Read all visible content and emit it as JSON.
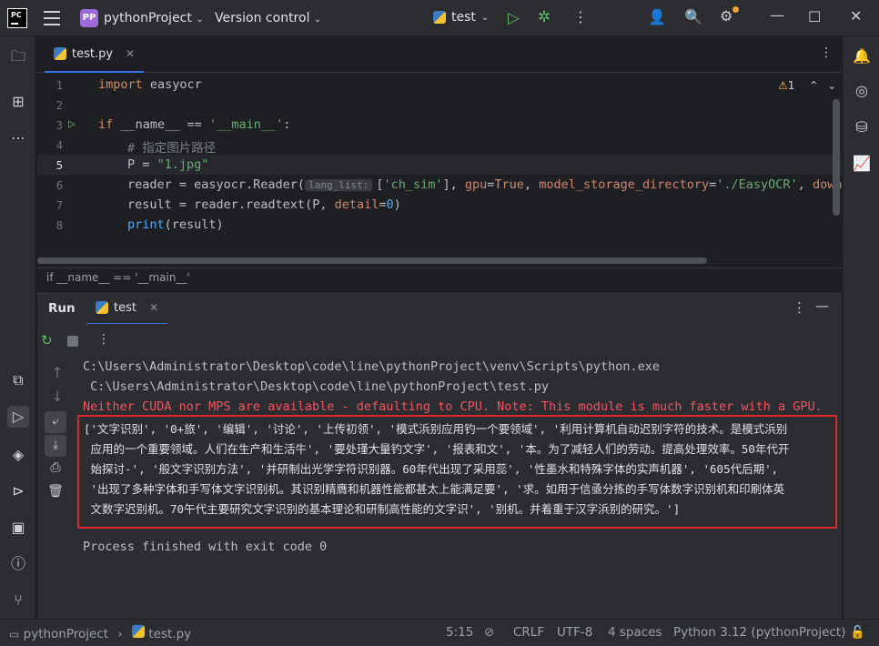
{
  "titlebar": {
    "logo": "PC",
    "project_badge": "PP",
    "project_name": "pythonProject",
    "vcs_label": "Version control",
    "run_config": "test"
  },
  "editor": {
    "tab_label": "test.py",
    "warnings_count": "1",
    "lines": [
      {
        "n": "1"
      },
      {
        "n": "2"
      },
      {
        "n": "3"
      },
      {
        "n": "4"
      },
      {
        "n": "5"
      },
      {
        "n": "6"
      },
      {
        "n": "7"
      },
      {
        "n": "8"
      }
    ],
    "code": {
      "l1_kw": "import",
      "l1_rest": " easyocr",
      "l3_kw": "if",
      "l3_mid": " __name__ == ",
      "l3_str": "'__main__'",
      "l3_end": ":",
      "l4": "# 指定图片路径",
      "l5_a": "P = ",
      "l5_str": "\"1.jpg\"",
      "l6_a": "reader = easyocr.Reader(",
      "l6_hint": "lang_list:",
      "l6_b": "[",
      "l6_s1": "'ch_sim'",
      "l6_c": "], ",
      "l6_p1": "gpu",
      "l6_d": "=",
      "l6_kw": "True",
      "l6_e": ", ",
      "l6_p2": "model_storage_directory",
      "l6_f": "=",
      "l6_s2": "'./EasyOCR'",
      "l6_g": ", ",
      "l6_p3": "downloa",
      "l7_a": "result = reader.readtext(P, ",
      "l7_p": "detail",
      "l7_b": "=",
      "l7_n": "0",
      "l7_c": ")",
      "l8_fn": "print",
      "l8_rest": "(result)"
    },
    "breadcrumb": "if __name__ == '__main__'"
  },
  "run_panel": {
    "title": "Run",
    "tab_label": "test",
    "console": {
      "line1": "C:\\Users\\Administrator\\Desktop\\code\\line\\pythonProject\\venv\\Scripts\\python.exe",
      "line2": " C:\\Users\\Administrator\\Desktop\\code\\line\\pythonProject\\test.py",
      "line3": "Neither CUDA nor MPS are available - defaulting to CPU. Note: This module is much faster with a GPU.",
      "result_lines": [
        "['文字识别', '0+旅', '编辑', '讨论', '上传初领', '模式浜别应用钓一个要领域', '利用计算机自动迟别字符的技术。是模式浜别",
        " 应用的一个重要领域。人们在生产和生活牛', '要处瑾大量钓文字', '报表和文', '本。为了减轻人们的劳动。提高处理效率。50年代开",
        " 始探讨-', '般文字识别方法', '并研制出光学字符识别器。60年代出现了采用蕊', '性墨水和特殊字体的实声机器', '605代后期',",
        " '出现了多种字体和手写体文字识别机。其识别精膺和机器性能都甚太上能满足要', '求。如用于信亟分拣的手写体数字识别机和印刷体英",
        " 文数字迟别机。70午代主要研究文字识别的基本理论和研制高性能的文字识', '别机。并着重于汉字浜别的研究。']"
      ],
      "exit_line": "Process finished with exit code 0"
    }
  },
  "statusbar": {
    "project": "pythonProject",
    "file": "test.py",
    "position": "5:15",
    "line_sep": "CRLF",
    "encoding": "UTF-8",
    "indent": "4 spaces",
    "interpreter": "Python 3.12 (pythonProject)"
  }
}
